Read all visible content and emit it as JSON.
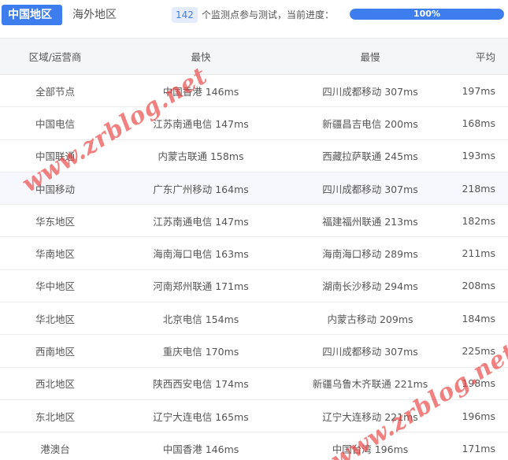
{
  "tabs": [
    {
      "label": "中国地区",
      "active": true
    },
    {
      "label": "海外地区",
      "active": false
    }
  ],
  "monitor_count": "142",
  "progress_text": "个监测点参与测试，当前进度：",
  "progress": {
    "value": 100,
    "label": "100%"
  },
  "colors": {
    "accent": "#3d7ded",
    "watermark": "#eb4646"
  },
  "table": {
    "headers": [
      "区域/运营商",
      "最快",
      "最慢",
      "平均"
    ],
    "rows": [
      [
        "全部节点",
        "中国香港 146ms",
        "四川成都移动 307ms",
        "197ms"
      ],
      [
        "中国电信",
        "江苏南通电信 147ms",
        "新疆昌吉电信 200ms",
        "168ms"
      ],
      [
        "中国联通",
        "内蒙古联通 158ms",
        "西藏拉萨联通 245ms",
        "193ms"
      ],
      [
        "中国移动",
        "广东广州移动 164ms",
        "四川成都移动 307ms",
        "218ms"
      ],
      [
        "华东地区",
        "江苏南通电信 147ms",
        "福建福州联通 213ms",
        "182ms"
      ],
      [
        "华南地区",
        "海南海口电信 163ms",
        "海南海口移动 289ms",
        "211ms"
      ],
      [
        "华中地区",
        "河南郑州联通 171ms",
        "湖南长沙移动 294ms",
        "208ms"
      ],
      [
        "华北地区",
        "北京电信 154ms",
        "内蒙古移动 209ms",
        "184ms"
      ],
      [
        "西南地区",
        "重庆电信 170ms",
        "四川成都移动 307ms",
        "225ms"
      ],
      [
        "西北地区",
        "陕西西安电信 174ms",
        "新疆乌鲁木齐联通 221ms",
        "198ms"
      ],
      [
        "东北地区",
        "辽宁大连电信 165ms",
        "辽宁大连移动 221ms",
        "196ms"
      ],
      [
        "港澳台",
        "中国香港 146ms",
        "中国台湾 196ms",
        "171ms"
      ]
    ],
    "highlighted_row": 3
  },
  "watermark": "www.zrblog.net"
}
